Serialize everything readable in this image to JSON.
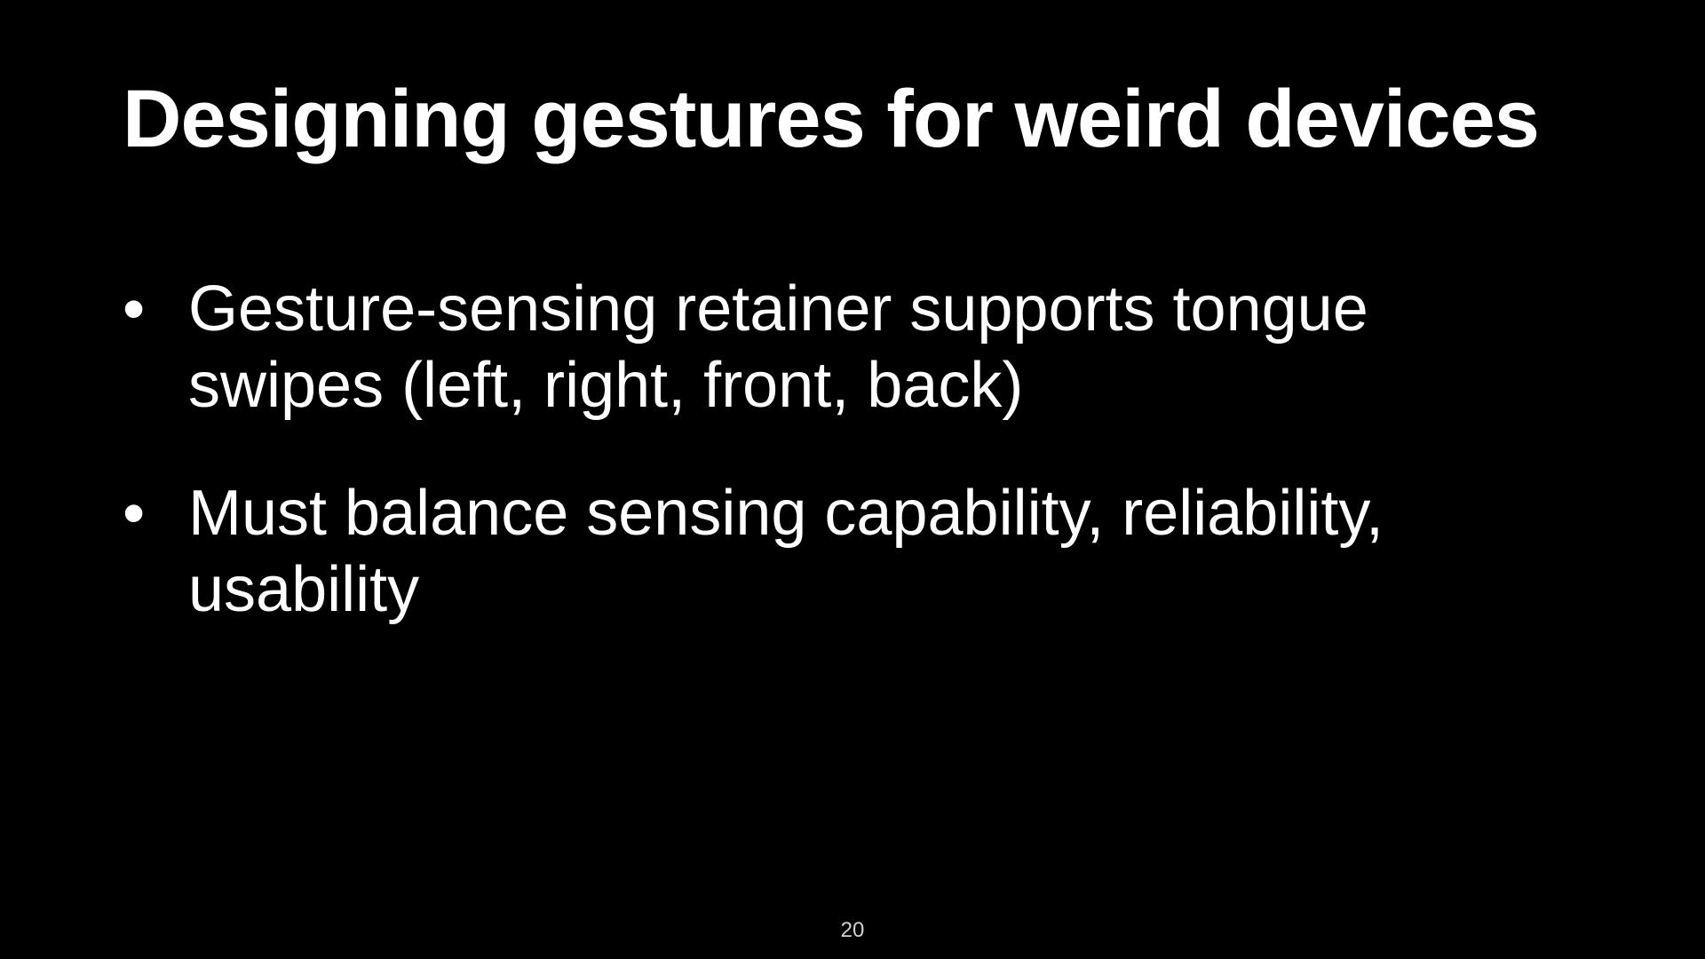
{
  "slide": {
    "title": "Designing gestures for weird devices",
    "bullets": [
      {
        "marker": "•",
        "text": "Gesture-sensing retainer supports tongue swipes (left, right, front, back)"
      },
      {
        "marker": "•",
        "text": "Must balance sensing capability, reliability, usability"
      }
    ],
    "page_number": "20"
  },
  "colors": {
    "background": "#000000",
    "text": "#ffffff"
  }
}
